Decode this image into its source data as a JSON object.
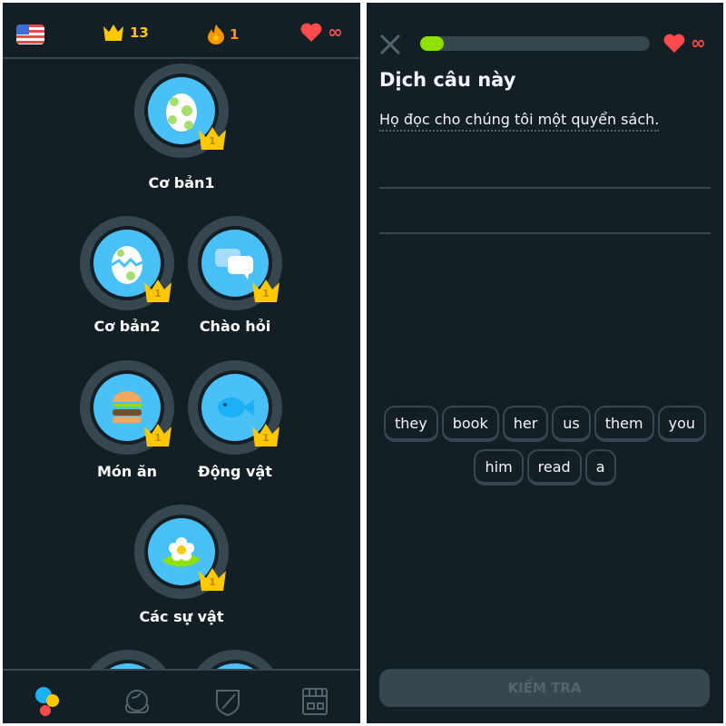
{
  "left": {
    "topbar": {
      "crowns": "13",
      "streak": "1",
      "hearts": "∞",
      "flag_icon": "us-flag-icon"
    },
    "skills": [
      {
        "label": "Cơ bản1",
        "level": "1",
        "icon": "egg-icon"
      },
      {
        "label": "Cơ bản2",
        "level": "1",
        "icon": "cracked-egg-icon"
      },
      {
        "label": "Chào hỏi",
        "level": "1",
        "icon": "speech-bubbles-icon"
      },
      {
        "label": "Món ăn",
        "level": "1",
        "icon": "burger-icon"
      },
      {
        "label": "Động vật",
        "level": "1",
        "icon": "fish-icon"
      },
      {
        "label": "Các sự vật",
        "level": "1",
        "icon": "flower-icon"
      }
    ],
    "nav": [
      "learn-icon",
      "profile-icon",
      "leagues-shield-icon",
      "shop-icon"
    ]
  },
  "right": {
    "hearts": "∞",
    "progress": 0.06,
    "title": "Dịch câu này",
    "sentence": "Họ đọc cho chúng tôi một quyển sách.",
    "word_bank_row1": [
      "they",
      "book",
      "her",
      "us",
      "them",
      "you"
    ],
    "word_bank_row2": [
      "him",
      "read",
      "a"
    ],
    "check_button": "KIỂM TRA"
  },
  "colors": {
    "background": "#131f24",
    "skill_blue": "#49c0f8",
    "crown": "#ffc800",
    "heart": "#ff4b4b",
    "streak": "#ff9600",
    "progress": "#8ee000"
  }
}
